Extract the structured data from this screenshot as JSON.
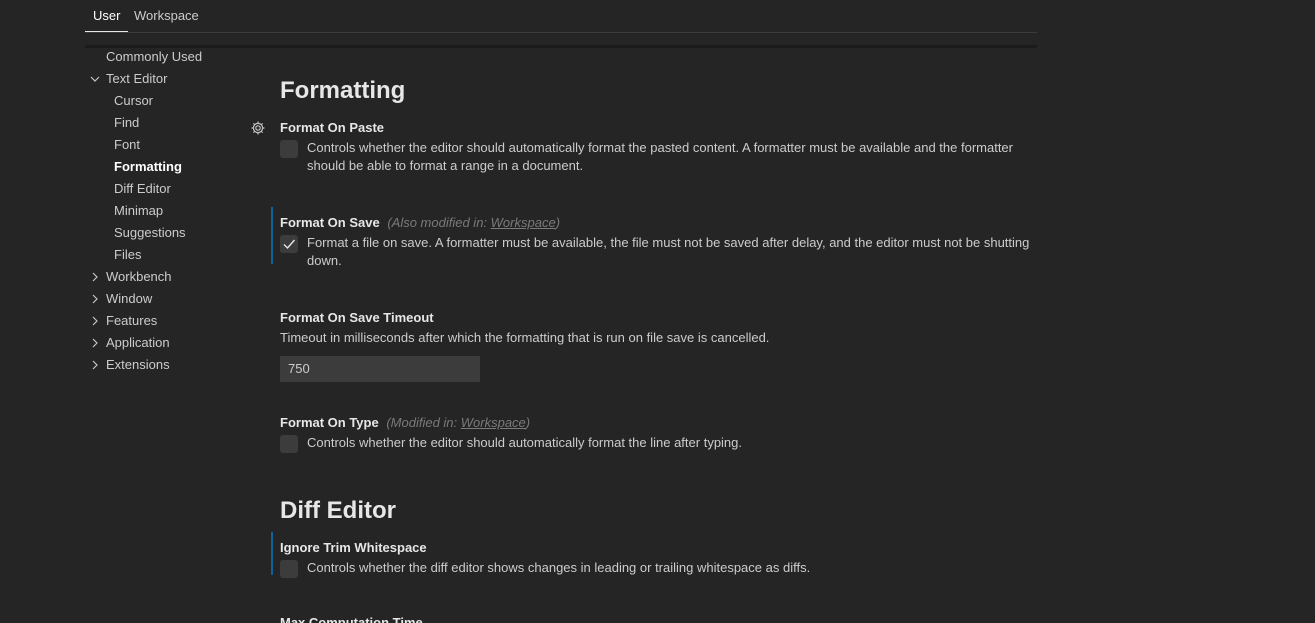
{
  "tabs": {
    "user": "User",
    "workspace": "Workspace"
  },
  "toc": {
    "commonly_used": "Commonly Used",
    "text_editor": "Text Editor",
    "cursor": "Cursor",
    "find": "Find",
    "font": "Font",
    "formatting": "Formatting",
    "diff_editor": "Diff Editor",
    "minimap": "Minimap",
    "suggestions": "Suggestions",
    "files": "Files",
    "workbench": "Workbench",
    "window": "Window",
    "features": "Features",
    "application": "Application",
    "extensions": "Extensions"
  },
  "sections": {
    "formatting": "Formatting",
    "diff_editor": "Diff Editor"
  },
  "settings": {
    "format_on_paste": {
      "title": "Format On Paste",
      "description": "Controls whether the editor should automatically format the pasted content. A formatter must be available and the formatter should be able to format a range in a document.",
      "checked": false
    },
    "format_on_save": {
      "title": "Format On Save",
      "modified_prefix": "(Also modified in: ",
      "modified_link": "Workspace",
      "modified_suffix": ")",
      "description": "Format a file on save. A formatter must be available, the file must not be saved after delay, and the editor must not be shutting down.",
      "checked": true
    },
    "format_on_save_timeout": {
      "title": "Format On Save Timeout",
      "description": "Timeout in milliseconds after which the formatting that is run on file save is cancelled.",
      "value": "750"
    },
    "format_on_type": {
      "title": "Format On Type",
      "modified_prefix": "(Modified in: ",
      "modified_link": "Workspace",
      "modified_suffix": ")",
      "description": "Controls whether the editor should automatically format the line after typing.",
      "checked": false
    },
    "ignore_trim_whitespace": {
      "title": "Ignore Trim Whitespace",
      "description": "Controls whether the diff editor shows changes in leading or trailing whitespace as diffs.",
      "checked": false
    },
    "max_computation_time": {
      "title": "Max Computation Time"
    }
  },
  "colors": {
    "background": "#252526",
    "modified_indicator": "#0e639c",
    "checkbox_background": "#3c3c3c"
  },
  "icons": {
    "gear": "gear-icon",
    "chevron_down": "chevron-down-icon",
    "chevron_right": "chevron-right-icon",
    "check": "check-icon"
  }
}
